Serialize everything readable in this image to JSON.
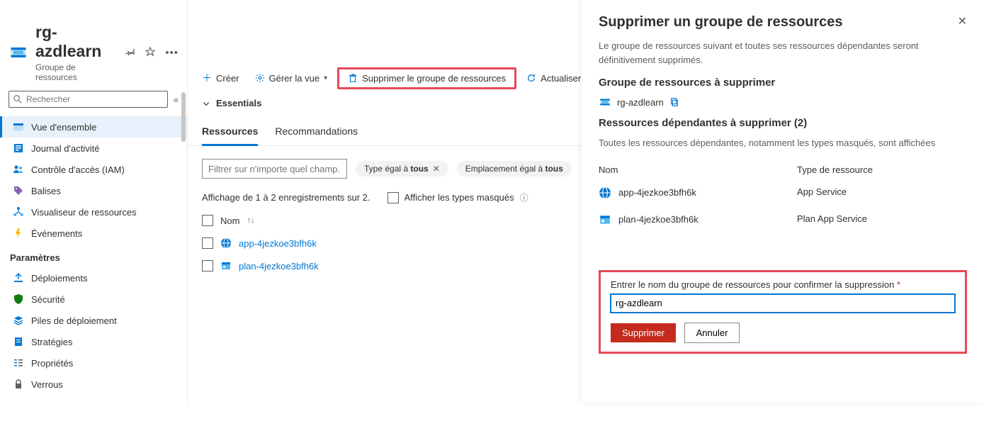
{
  "header": {
    "title": "rg-azdlearn",
    "subtitle": "Groupe de ressources"
  },
  "search": {
    "placeholder": "Rechercher"
  },
  "sidebar": {
    "items": [
      {
        "label": "Vue d'ensemble"
      },
      {
        "label": "Journal d'activité"
      },
      {
        "label": "Contrôle d'accès (IAM)"
      },
      {
        "label": "Balises"
      },
      {
        "label": "Visualiseur de ressources"
      },
      {
        "label": "Événements"
      }
    ],
    "section": "Paramètres",
    "settings": [
      {
        "label": "Déploiements"
      },
      {
        "label": "Sécurité"
      },
      {
        "label": "Piles de déploiement"
      },
      {
        "label": "Stratégies"
      },
      {
        "label": "Propriétés"
      },
      {
        "label": "Verrous"
      }
    ]
  },
  "toolbar": {
    "create": "Créer",
    "manage": "Gérer la vue",
    "delete": "Supprimer le groupe de ressources",
    "refresh": "Actualiser"
  },
  "essentials": "Essentials",
  "tabs": {
    "resources": "Ressources",
    "recommend": "Recommandations"
  },
  "filter": {
    "placeholder": "Filtrer sur n'importe quel champ...",
    "type_prefix": "Type égal à ",
    "type_value": "tous",
    "loc_prefix": "Emplacement égal à ",
    "loc_value": "tous"
  },
  "list": {
    "count_text": "Affichage de 1 à 2 enregistrements sur 2.",
    "show_hidden": "Afficher les types masqués",
    "col_name": "Nom",
    "rows": [
      {
        "name": "app-4jezkoe3bfh6k",
        "icon": "globe"
      },
      {
        "name": "plan-4jezkoe3bfh6k",
        "icon": "plan"
      }
    ]
  },
  "panel": {
    "title": "Supprimer un groupe de ressources",
    "desc": "Le groupe de ressources suivant et toutes ses ressources dépendantes seront définitivement supprimés.",
    "rg_heading": "Groupe de ressources à supprimer",
    "rg_name": "rg-azdlearn",
    "dep_heading": "Ressources dépendantes à supprimer (2)",
    "dep_note": "Toutes les ressources dépendantes, notamment les types masqués, sont affichées",
    "col_name": "Nom",
    "col_type": "Type de ressource",
    "deps": [
      {
        "name": "app-4jezkoe3bfh6k",
        "type": "App Service",
        "icon": "globe"
      },
      {
        "name": "plan-4jezkoe3bfh6k",
        "type": "Plan App Service",
        "icon": "plan"
      }
    ],
    "confirm_label": "Entrer le nom du groupe de ressources pour confirmer la suppression",
    "confirm_value": "rg-azdlearn",
    "delete_btn": "Supprimer",
    "cancel_btn": "Annuler"
  }
}
